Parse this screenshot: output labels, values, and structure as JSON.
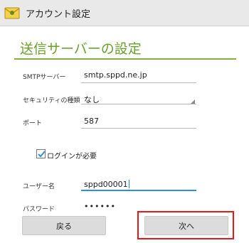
{
  "app": {
    "title": "アカウント設定",
    "icon": "email-icon"
  },
  "page": {
    "title": "送信サーバーの設定"
  },
  "fields": {
    "smtp": {
      "label": "SMTPサーバー",
      "value": "smtp.sppd.ne.jp"
    },
    "security": {
      "label": "セキュリティの種類",
      "value": "なし"
    },
    "port": {
      "label": "ポート",
      "value": "587"
    },
    "login_required": {
      "label": "ログインが必要",
      "checked": true
    },
    "username": {
      "label": "ユーザー名",
      "value": "sppd00001"
    },
    "password": {
      "label": "パスワード",
      "value": "••••••"
    }
  },
  "buttons": {
    "back": "戻る",
    "next": "次へ"
  },
  "colors": {
    "accent_green": "#6aa02e",
    "focus_blue": "#2d8fd5",
    "highlight_red": "#e51919"
  }
}
